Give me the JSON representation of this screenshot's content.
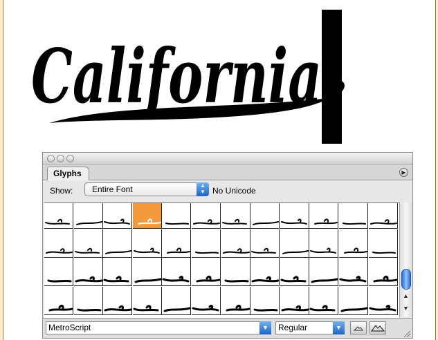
{
  "artwork": {
    "word": "California"
  },
  "palette": {
    "tab_label": "Glyphs",
    "show_label": "Show:",
    "show_value": "Entire Font",
    "unicode_label": "No Unicode",
    "font_name": "MetroScript",
    "font_style": "Regular",
    "selected_cell": 3,
    "scroll_position": 0.75,
    "icons": {
      "panel_menu": "panel-menu-icon",
      "dropdown": "chevron-down-icon",
      "zoom_out": "small-mountain-icon",
      "zoom_in": "large-mountain-icon",
      "resize": "resize-grip-icon"
    },
    "colors": {
      "selection": "#f39a3c",
      "accent": "#1d63c9",
      "page_background": "#fbeec4"
    }
  }
}
